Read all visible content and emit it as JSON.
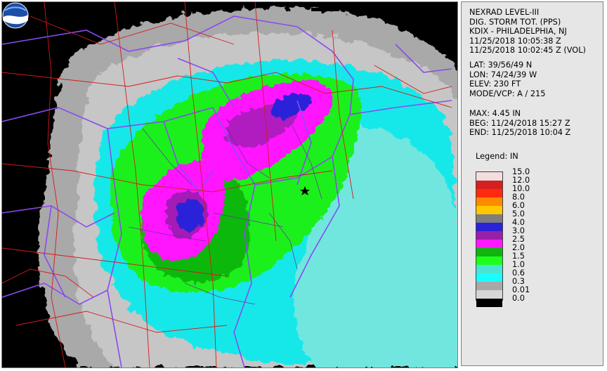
{
  "header": {
    "lines": [
      "NEXRAD LEVEL-III",
      "DIG. STORM TOT. (PPS)",
      "KDIX - PHILADELPHIA, NJ",
      "11/25/2018 10:05:38 Z",
      "11/25/2018 10:02:45 Z (VOL)"
    ]
  },
  "site": {
    "lines": [
      "LAT: 39/56/49 N",
      "LON: 74/24/39 W",
      "ELEV: 230 FT",
      "MODE/VCP: A / 215"
    ]
  },
  "stats": {
    "lines": [
      "MAX: 4.45 IN",
      "BEG: 11/24/2018 15:27 Z",
      "END: 11/25/2018 10:04 Z"
    ]
  },
  "legend": {
    "title": "Legend: IN",
    "entries": [
      {
        "label": "15.0",
        "color": "#f2dede"
      },
      {
        "label": "12.0",
        "color": "#d42020"
      },
      {
        "label": "10.0",
        "color": "#ff2a0e"
      },
      {
        "label": "8.0",
        "color": "#ff8a00"
      },
      {
        "label": "6.0",
        "color": "#ffc800"
      },
      {
        "label": "5.0",
        "color": "#7e7e7e"
      },
      {
        "label": "4.0",
        "color": "#2a22d8"
      },
      {
        "label": "3.0",
        "color": "#9a1fa8"
      },
      {
        "label": "2.5",
        "color": "#ff19ff"
      },
      {
        "label": "2.0",
        "color": "#0fb40f"
      },
      {
        "label": "1.5",
        "color": "#1fff1f"
      },
      {
        "label": "1.0",
        "color": "#4be3d6"
      },
      {
        "label": "0.6",
        "color": "#19ffff"
      },
      {
        "label": "0.3",
        "color": "#a8a8a8"
      },
      {
        "label": "0.01",
        "color": "#d6d6d6"
      },
      {
        "label": "0.0",
        "color": "#000000"
      }
    ]
  },
  "map": {
    "radar_site_icon": "star-icon",
    "logo_icon": "noaa-logo-icon",
    "state_border_color": "#8a4af0",
    "road_color": "#d41a1a",
    "county_color": "#6b2aa8"
  }
}
